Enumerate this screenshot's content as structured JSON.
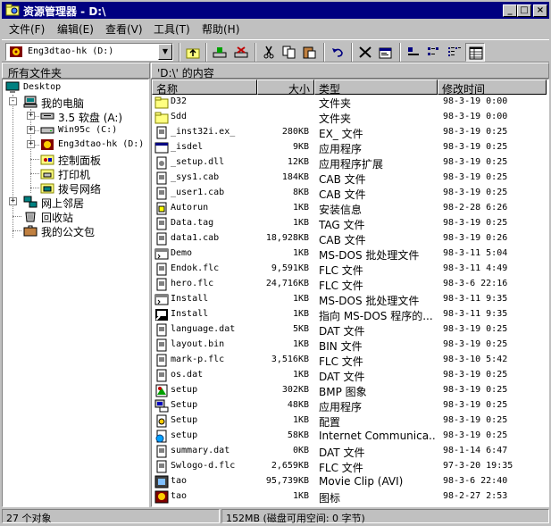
{
  "window": {
    "title": "资源管理器 - D:\\",
    "buttons": {
      "minimize": "_",
      "maximize": "□",
      "close": "×"
    }
  },
  "menu": [
    "文件(F)",
    "编辑(E)",
    "查看(V)",
    "工具(T)",
    "帮助(H)"
  ],
  "address": {
    "value": "Eng3dtao-hk (D:)"
  },
  "toolbar": {
    "icons": [
      "up-folder-icon",
      "map-drive-icon",
      "disconnect-drive-icon",
      "cut-icon",
      "copy-icon",
      "paste-icon",
      "undo-icon",
      "delete-icon",
      "properties-icon",
      "large-icons-view-icon",
      "small-icons-view-icon",
      "list-view-icon",
      "details-view-icon"
    ]
  },
  "panes": {
    "tree_title": "所有文件夹",
    "content_title": "'D:\\' 的内容"
  },
  "tree": [
    {
      "label": "Desktop",
      "icon": "desktop-icon",
      "level": 0,
      "expander": ""
    },
    {
      "label": "我的电脑",
      "icon": "my-computer-icon",
      "level": 1,
      "expander": "-"
    },
    {
      "label": "3.5 软盘 (A:)",
      "icon": "floppy-drive-icon",
      "level": 2,
      "expander": "+"
    },
    {
      "label": "Win95c (C:)",
      "icon": "hard-drive-icon",
      "level": 2,
      "expander": "+"
    },
    {
      "label": "Eng3dtao-hk (D:)",
      "icon": "cd-drive-icon",
      "level": 2,
      "expander": "+"
    },
    {
      "label": "控制面板",
      "icon": "control-panel-icon",
      "level": 2,
      "expander": ""
    },
    {
      "label": "打印机",
      "icon": "printers-folder-icon",
      "level": 2,
      "expander": ""
    },
    {
      "label": "拨号网络",
      "icon": "dialup-network-icon",
      "level": 2,
      "expander": ""
    },
    {
      "label": "网上邻居",
      "icon": "network-neighborhood-icon",
      "level": 1,
      "expander": "+"
    },
    {
      "label": "回收站",
      "icon": "recycle-bin-icon",
      "level": 1,
      "expander": ""
    },
    {
      "label": "我的公文包",
      "icon": "briefcase-icon",
      "level": 1,
      "expander": ""
    }
  ],
  "columns": {
    "name": "名称",
    "size": "大小",
    "type": "类型",
    "modified": "修改时间"
  },
  "files": [
    {
      "name": "D32",
      "size": "",
      "type": "文件夹",
      "modified": "98-3-19 0:00",
      "icon": "folder-icon"
    },
    {
      "name": "Sdd",
      "size": "",
      "type": "文件夹",
      "modified": "98-3-19 0:00",
      "icon": "folder-icon"
    },
    {
      "name": "_inst32i.ex_",
      "size": "280KB",
      "type": "EX_ 文件",
      "modified": "98-3-19 0:25",
      "icon": "file-icon"
    },
    {
      "name": "_isdel",
      "size": "9KB",
      "type": "应用程序",
      "modified": "98-3-19 0:25",
      "icon": "app-icon"
    },
    {
      "name": "_setup.dll",
      "size": "12KB",
      "type": "应用程序扩展",
      "modified": "98-3-19 0:25",
      "icon": "dll-icon"
    },
    {
      "name": "_sys1.cab",
      "size": "184KB",
      "type": "CAB 文件",
      "modified": "98-3-19 0:25",
      "icon": "file-icon"
    },
    {
      "name": "_user1.cab",
      "size": "8KB",
      "type": "CAB 文件",
      "modified": "98-3-19 0:25",
      "icon": "file-icon"
    },
    {
      "name": "Autorun",
      "size": "1KB",
      "type": "安装信息",
      "modified": "98-2-28 6:26",
      "icon": "setup-info-icon"
    },
    {
      "name": "Data.tag",
      "size": "1KB",
      "type": "TAG 文件",
      "modified": "98-3-19 0:25",
      "icon": "file-icon"
    },
    {
      "name": "data1.cab",
      "size": "18,928KB",
      "type": "CAB 文件",
      "modified": "98-3-19 0:26",
      "icon": "file-icon"
    },
    {
      "name": "Demo",
      "size": "1KB",
      "type": "MS-DOS 批处理文件",
      "modified": "98-3-11 5:04",
      "icon": "batch-icon"
    },
    {
      "name": "Endok.flc",
      "size": "9,591KB",
      "type": "FLC 文件",
      "modified": "98-3-11 4:49",
      "icon": "file-icon"
    },
    {
      "name": "hero.flc",
      "size": "24,716KB",
      "type": "FLC 文件",
      "modified": "98-3-6 22:16",
      "icon": "file-icon"
    },
    {
      "name": "Install",
      "size": "1KB",
      "type": "MS-DOS 批处理文件",
      "modified": "98-3-11 9:35",
      "icon": "batch-icon"
    },
    {
      "name": "Install",
      "size": "1KB",
      "type": "指向 MS-DOS 程序的...",
      "modified": "98-3-11 9:35",
      "icon": "msdos-shortcut-icon"
    },
    {
      "name": "language.dat",
      "size": "5KB",
      "type": "DAT 文件",
      "modified": "98-3-19 0:25",
      "icon": "file-icon"
    },
    {
      "name": "layout.bin",
      "size": "1KB",
      "type": "BIN 文件",
      "modified": "98-3-19 0:25",
      "icon": "file-icon"
    },
    {
      "name": "mark-p.flc",
      "size": "3,516KB",
      "type": "FLC 文件",
      "modified": "98-3-10 5:42",
      "icon": "file-icon"
    },
    {
      "name": "os.dat",
      "size": "1KB",
      "type": "DAT 文件",
      "modified": "98-3-19 0:25",
      "icon": "file-icon"
    },
    {
      "name": "setup",
      "size": "302KB",
      "type": "BMP 图象",
      "modified": "98-3-19 0:25",
      "icon": "bitmap-icon"
    },
    {
      "name": "Setup",
      "size": "48KB",
      "type": "应用程序",
      "modified": "98-3-19 0:25",
      "icon": "setup-app-icon"
    },
    {
      "name": "Setup",
      "size": "1KB",
      "type": "配置",
      "modified": "98-3-19 0:25",
      "icon": "config-icon"
    },
    {
      "name": "setup",
      "size": "58KB",
      "type": "Internet Communica...",
      "modified": "98-3-19 0:25",
      "icon": "internet-file-icon"
    },
    {
      "name": "summary.dat",
      "size": "0KB",
      "type": "DAT 文件",
      "modified": "98-1-14 6:47",
      "icon": "file-icon"
    },
    {
      "name": "Swlogo-d.flc",
      "size": "2,659KB",
      "type": "FLC 文件",
      "modified": "97-3-20 19:35",
      "icon": "file-icon"
    },
    {
      "name": "tao",
      "size": "95,739KB",
      "type": "Movie Clip (AVI)",
      "modified": "98-3-6 22:40",
      "icon": "movie-icon"
    },
    {
      "name": "tao",
      "size": "1KB",
      "type": "图标",
      "modified": "98-2-27 2:53",
      "icon": "icon-file-icon"
    }
  ],
  "status": {
    "objects": "27 个对象",
    "disk": "152MB (磁盘可用空间: 0 字节)"
  }
}
